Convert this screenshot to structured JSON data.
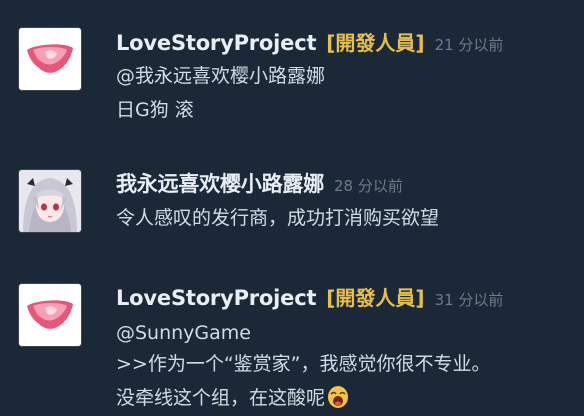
{
  "comments": [
    {
      "author": "LoveStoryProject",
      "badge": "[開發人員]",
      "time": "21 分以前",
      "avatar_icon": "pink-heart-logo-icon",
      "lines": [
        "@我永远喜欢樱小路露娜",
        "日G狗 滚"
      ]
    },
    {
      "author": "我永远喜欢樱小路露娜",
      "badge": "",
      "time": "28 分以前",
      "avatar_icon": "anime-girl-avatar-icon",
      "lines": [
        "令人感叹的发行商，成功打消购买欲望"
      ]
    },
    {
      "author": "LoveStoryProject",
      "badge": "[開發人員]",
      "time": "31 分以前",
      "avatar_icon": "pink-heart-logo-icon",
      "lines": [
        "@SunnyGame",
        ">>作为一个“鉴赏家”，我感觉你很不专业。",
        "没牵线这个组，在这酸呢"
      ],
      "trailing_icon": "laughing-emoji-icon"
    }
  ],
  "colors": {
    "background": "#1b2838",
    "author": "#e8eef4",
    "badge": "#e7c04c",
    "timestamp": "#6f7a86",
    "text": "#d3dce4"
  }
}
